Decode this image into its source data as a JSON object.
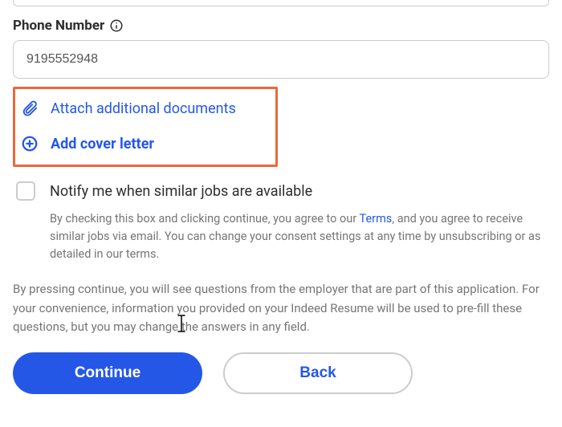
{
  "phone": {
    "label": "Phone Number",
    "value": "9195552948"
  },
  "attachments": {
    "attach_docs": "Attach additional documents",
    "add_cover": "Add cover letter"
  },
  "notify": {
    "label": "Notify me when similar jobs are available",
    "consent_prefix": "By checking this box and clicking continue, you agree to our ",
    "terms_link": "Terms",
    "consent_suffix": ", and you agree to receive similar jobs via email. You can change your consent settings at any time by unsubscribing or as detailed in our terms."
  },
  "disclaimer": "By pressing continue, you will see questions from the employer that are part of this application. For your convenience, information you provided on your Indeed Resume will be used to pre-fill these questions, but you may change the answers in any field.",
  "buttons": {
    "continue": "Continue",
    "back": "Back"
  }
}
